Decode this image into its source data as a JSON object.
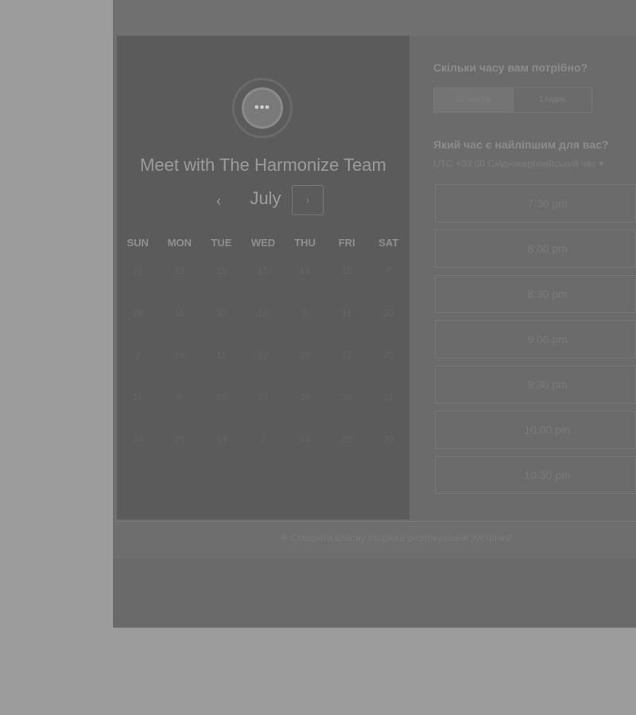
{
  "calendar": {
    "logo_glyph": "•••",
    "title": "Meet with The Harmonize Team",
    "prev_glyph": "‹",
    "month": "July",
    "next_glyph": "›",
    "weekdays": [
      "SUN",
      "MON",
      "TUE",
      "WED",
      "THU",
      "FRI",
      "SAT"
    ],
    "weeks": [
      [
        "28",
        "23",
        "15",
        "15",
        "15",
        "16",
        "7"
      ],
      [
        "26",
        "11",
        "30",
        "18",
        "9",
        "31",
        "20"
      ],
      [
        "2",
        "19",
        "11",
        "27",
        "28",
        "12",
        "20"
      ],
      [
        "11",
        "8",
        "20",
        "27",
        "30",
        "26",
        "21"
      ],
      [
        "24",
        "26",
        "14",
        "2",
        "14",
        "20",
        "29"
      ]
    ]
  },
  "scheduler": {
    "duration_question": "Скільки часу вам потрібно?",
    "durations": [
      "30 хвилин",
      "1 годин"
    ],
    "time_question": "Який час є найліпшим для вас?",
    "timezone": "UTC +03:00 Східноєвропейський час ▾",
    "slots": [
      "7:30 pm",
      "8:00 pm",
      "8:30 pm",
      "9:00 pm",
      "9:30 pm",
      "10:00 pm",
      "10:30 pm"
    ]
  },
  "footer": {
    "link": "✈ Створити власну сторінка резервування зустрічей"
  }
}
